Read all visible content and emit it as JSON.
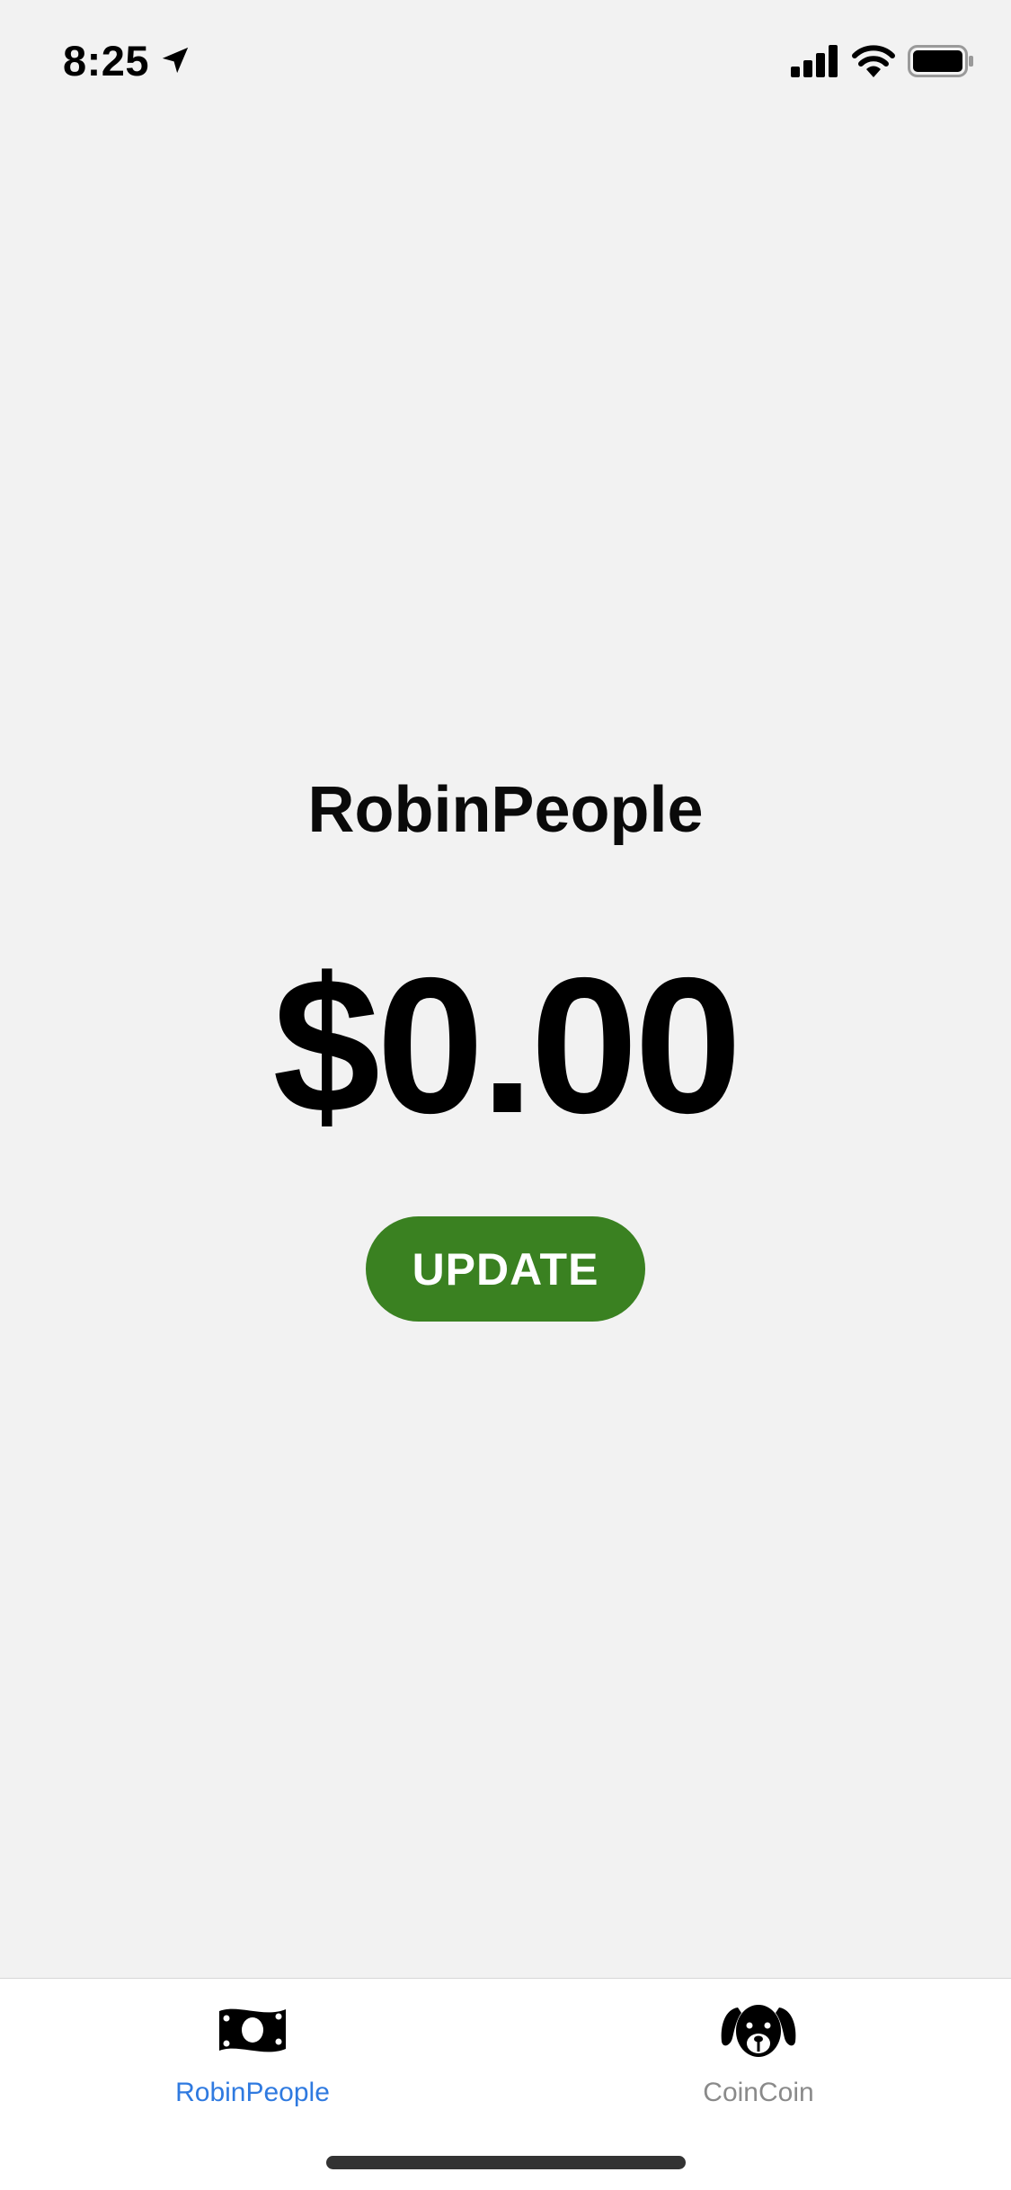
{
  "status_bar": {
    "time": "8:25",
    "icons": [
      "location-arrow-icon",
      "cellular-signal-icon",
      "wifi-icon",
      "battery-icon"
    ]
  },
  "main": {
    "title": "RobinPeople",
    "balance": "$0.00",
    "update_button_label": "UPDATE"
  },
  "tab_bar": {
    "tabs": [
      {
        "label": "RobinPeople",
        "icon": "money-bill-icon",
        "selected": true
      },
      {
        "label": "CoinCoin",
        "icon": "dog-icon",
        "selected": false
      }
    ]
  },
  "colors": {
    "background": "#f2f2f2",
    "update_button": "#3a8121",
    "tab_active": "#2f7ae0",
    "tab_inactive": "#8a8a8a"
  }
}
